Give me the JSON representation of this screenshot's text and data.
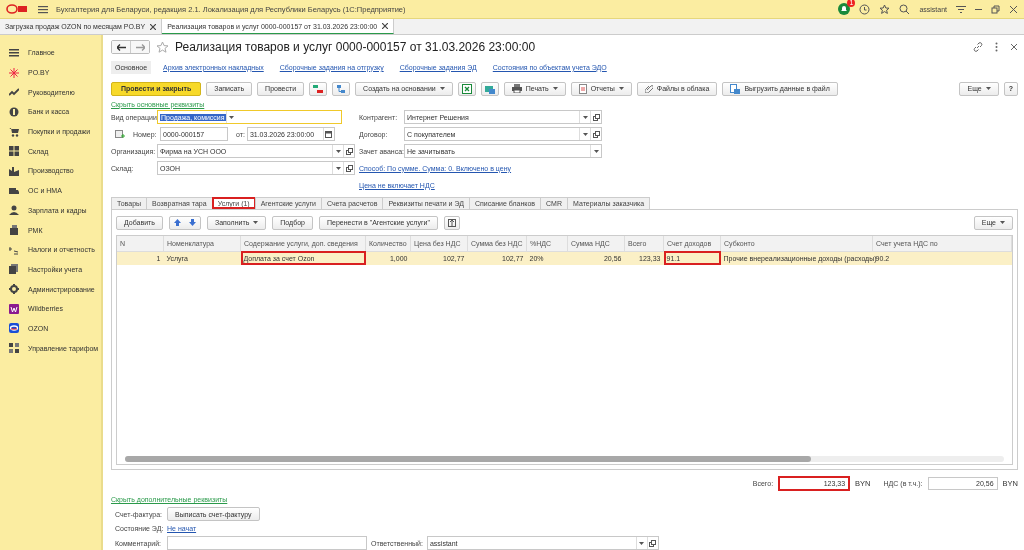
{
  "app": {
    "title": "Бухгалтерия для Беларуси, редакция 2.1. Локализация для Республики Беларусь  (1С:Предприятие)",
    "user": "assistant",
    "notifications": "1"
  },
  "open_tabs": [
    {
      "label": "Загрузка продаж OZON по месяцам PO.BY",
      "selected": false
    },
    {
      "label": "Реализация товаров и услуг 0000-000157 от 31.03.2026 23:00:00",
      "selected": true
    }
  ],
  "sidebar": {
    "items": [
      {
        "label": "Главное"
      },
      {
        "label": "PO.BY"
      },
      {
        "label": "Руководителю"
      },
      {
        "label": "Банк и касса"
      },
      {
        "label": "Покупки и продажи"
      },
      {
        "label": "Склад"
      },
      {
        "label": "Производство"
      },
      {
        "label": "ОС и НМА"
      },
      {
        "label": "Зарплата и кадры"
      },
      {
        "label": "РМК"
      },
      {
        "label": "Налоги и отчетность"
      },
      {
        "label": "Настройки учета"
      },
      {
        "label": "Администрирование"
      },
      {
        "label": "Wildberries"
      },
      {
        "label": "OZON"
      },
      {
        "label": "Управление тарифом"
      }
    ]
  },
  "document": {
    "title": "Реализация товаров и услуг 0000-000157 от 31.03.2026 23:00:00",
    "sections": [
      {
        "label": "Основное",
        "selected": true
      },
      {
        "label": "Архив электронных накладных",
        "selected": false
      },
      {
        "label": "Сборочные задания на отгрузку",
        "selected": false
      },
      {
        "label": "Сборочные задания ЭД",
        "selected": false
      },
      {
        "label": "Состояния по объектам учета ЭДО",
        "selected": false
      }
    ],
    "toolbar": [
      {
        "kind": "primary",
        "label": "Провести и закрыть"
      },
      {
        "kind": "button",
        "label": "Записать"
      },
      {
        "kind": "button",
        "label": "Провести"
      },
      {
        "kind": "icon"
      },
      {
        "kind": "icon"
      },
      {
        "kind": "menu",
        "label": "Создать на основании"
      },
      {
        "kind": "icon"
      },
      {
        "kind": "icon"
      },
      {
        "kind": "menu",
        "label": "Печать"
      },
      {
        "kind": "menu",
        "label": "Отчеты"
      },
      {
        "kind": "button",
        "label": "Файлы в облака"
      },
      {
        "kind": "button",
        "label": "Выгрузить данные в файл"
      }
    ],
    "more": "Еще",
    "help": "?",
    "hide_main": "Скрыть основные реквизиты",
    "operation": {
      "label": "Вид операции:",
      "value": "Продажа, комиссия"
    },
    "number": {
      "label": "Номер:",
      "value": "0000-000157",
      "date_label": "от:",
      "date": "31.03.2026 23:00:00"
    },
    "organization": {
      "label": "Организация:",
      "value": "Фирма на УСН ООО"
    },
    "warehouse": {
      "label": "Склад:",
      "value": "ОЗОН"
    },
    "counterparty": {
      "label": "Контрагент:",
      "value": "Интернет Решения"
    },
    "contract": {
      "label": "Договор:",
      "value": "С покупателем"
    },
    "advance": {
      "label": "Зачет аванса:",
      "value": "Не зачитывать"
    },
    "links": [
      "Способ: По сумме. Сумма: 0. Включено в цену",
      "Цена не включает НДС"
    ],
    "tabs": [
      {
        "label": "Товары",
        "selected": false,
        "highlighted": false
      },
      {
        "label": "Возвратная тара",
        "selected": false,
        "highlighted": false
      },
      {
        "label": "Услуги (1)",
        "selected": true,
        "highlighted": true
      },
      {
        "label": "Агентские услуги",
        "selected": false,
        "highlighted": false
      },
      {
        "label": "Счета расчетов",
        "selected": false,
        "highlighted": false
      },
      {
        "label": "Реквизиты печати и ЭД",
        "selected": false,
        "highlighted": false
      },
      {
        "label": "Списание бланков",
        "selected": false,
        "highlighted": false
      },
      {
        "label": "CMR",
        "selected": false,
        "highlighted": false
      },
      {
        "label": "Материалы заказчика",
        "selected": false,
        "highlighted": false
      }
    ],
    "table_toolbar": [
      {
        "kind": "button",
        "label": "Добавить"
      },
      {
        "kind": "arrows"
      },
      {
        "kind": "menu",
        "label": "Заполнить"
      },
      {
        "kind": "button",
        "label": "Подбор"
      },
      {
        "kind": "button",
        "label": "Перенести в \"Агентские услуги\""
      },
      {
        "kind": "icon"
      }
    ],
    "table_more": "Еще",
    "table": {
      "columns": [
        "N",
        "Номенклатура",
        "Содержание услуги, доп. сведения",
        "Количество",
        "Цена без НДС",
        "Сумма без НДС",
        "%НДС",
        "Сумма НДС",
        "Всего",
        "Счет доходов",
        "Субконто",
        "Счет учета НДС по"
      ],
      "rows": [
        {
          "selected": true,
          "cells": [
            {
              "text": "1",
              "highlighted": false
            },
            {
              "text": "Услуга",
              "highlighted": false
            },
            {
              "text": "Доплата за счет Ozon",
              "highlighted": true
            },
            {
              "text": "1,000",
              "highlighted": false
            },
            {
              "text": "102,77",
              "highlighted": false
            },
            {
              "text": "102,77",
              "highlighted": false
            },
            {
              "text": "20%",
              "highlighted": false
            },
            {
              "text": "20,56",
              "highlighted": false
            },
            {
              "text": "123,33",
              "highlighted": false
            },
            {
              "text": "91.1",
              "highlighted": true
            },
            {
              "text": "Прочие внереализационные доходы (расходы)",
              "highlighted": false
            },
            {
              "text": "90.2",
              "highlighted": false
            }
          ]
        }
      ]
    },
    "totals": [
      {
        "label": "Всего:",
        "value": "123,33",
        "currency": "BYN",
        "highlighted": true
      },
      {
        "label": "НДС (в т.ч.):",
        "value": "20,56",
        "currency": "BYN",
        "highlighted": false
      }
    ],
    "hide_extra": "Скрыть дополнительные реквизиты",
    "invoice": {
      "label": "Счет-фактура:",
      "button": "Выписать счет-фактуру"
    },
    "edo": {
      "label": "Состояние ЭД:",
      "value": "Не начат"
    },
    "comment": {
      "label": "Комментарий:"
    },
    "responsible": {
      "label": "Ответственный:",
      "value": "assistant"
    }
  }
}
